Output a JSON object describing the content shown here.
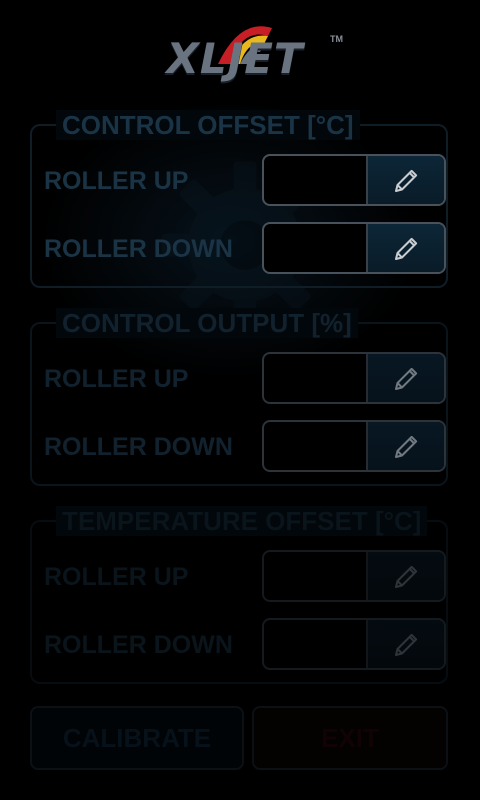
{
  "logo": {
    "text": "XLJET",
    "trademark": "TM"
  },
  "colors": {
    "background": "#000000",
    "accent_blue": "#0d2535",
    "label_blue": "#1a3446",
    "logo_red": "#d0202a",
    "logo_yellow": "#f0c020"
  },
  "groups": [
    {
      "title": "CONTROL OFFSET [°C]",
      "rows": [
        {
          "label": "ROLLER UP",
          "value": "",
          "edit_icon": "pencil-icon"
        },
        {
          "label": "ROLLER DOWN",
          "value": "",
          "edit_icon": "pencil-icon"
        }
      ]
    },
    {
      "title": "CONTROL OUTPUT [%]",
      "rows": [
        {
          "label": "ROLLER UP",
          "value": "",
          "edit_icon": "pencil-icon"
        },
        {
          "label": "ROLLER DOWN",
          "value": "",
          "edit_icon": "pencil-icon"
        }
      ]
    },
    {
      "title": "TEMPERATURE OFFSET [°C]",
      "rows": [
        {
          "label": "ROLLER UP",
          "value": "",
          "edit_icon": "pencil-icon"
        },
        {
          "label": "ROLLER DOWN",
          "value": "",
          "edit_icon": "pencil-icon"
        }
      ]
    }
  ],
  "buttons": {
    "calibrate_label": "CALIBRATE",
    "exit_label": "EXIT"
  }
}
